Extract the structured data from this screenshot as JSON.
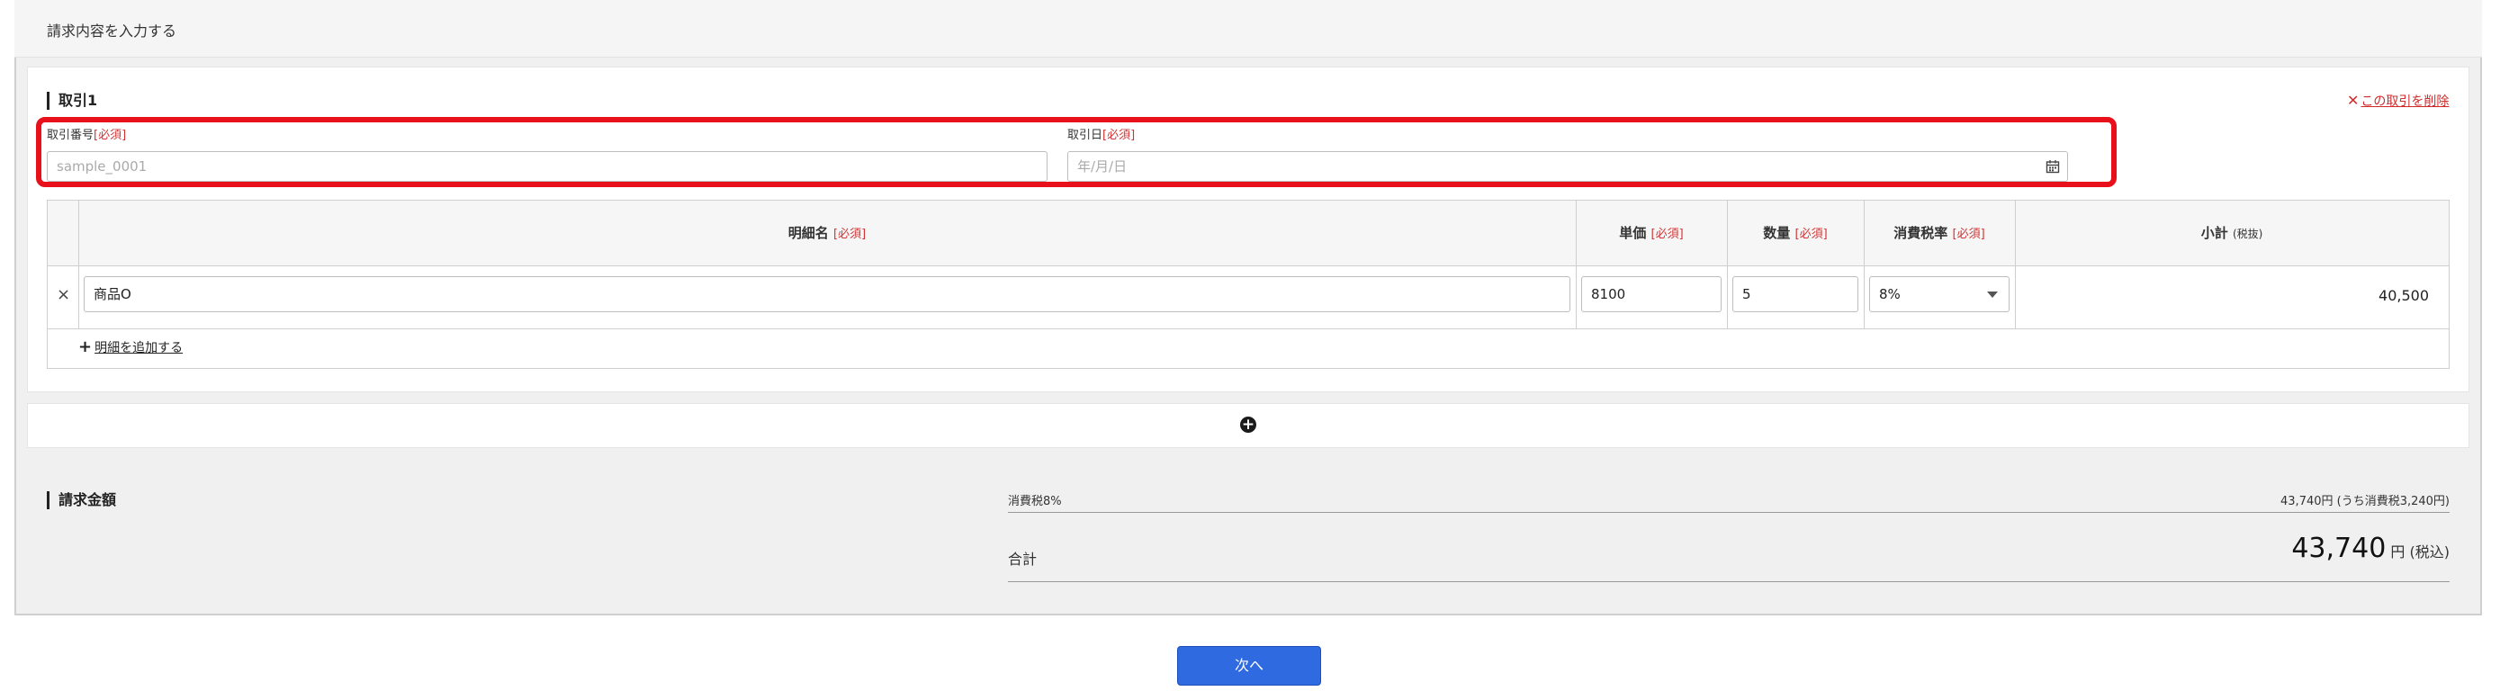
{
  "header": {
    "title": "請求内容を入力する"
  },
  "transaction": {
    "title": "取引1",
    "delete_label": "この取引を削除",
    "number_label": "取引番号",
    "number_placeholder": "sample_0001",
    "date_label": "取引日",
    "date_placeholder": "年/月/日",
    "required": "[必須]"
  },
  "table": {
    "headers": {
      "item_name": "明細名",
      "unit_price": "単価",
      "quantity": "数量",
      "tax_rate": "消費税率",
      "subtotal": "小計",
      "subtotal_note": "(税抜)"
    },
    "rows": [
      {
        "item_name": "商品O",
        "unit_price": "8100",
        "quantity": "5",
        "tax_rate": "8%",
        "subtotal": "40,500"
      }
    ],
    "add_line_label": "明細を追加する"
  },
  "summary": {
    "title": "請求金額",
    "tax_label": "消費税8%",
    "tax_value": "43,740円 (うち消費税3,240円)",
    "total_label": "合計",
    "total_value": "43,740",
    "total_unit": "円 (税込)"
  },
  "actions": {
    "next_label": "次へ"
  },
  "colors": {
    "accent": "#2f6ae1",
    "required": "#d13434",
    "highlight": "#e8111b"
  }
}
